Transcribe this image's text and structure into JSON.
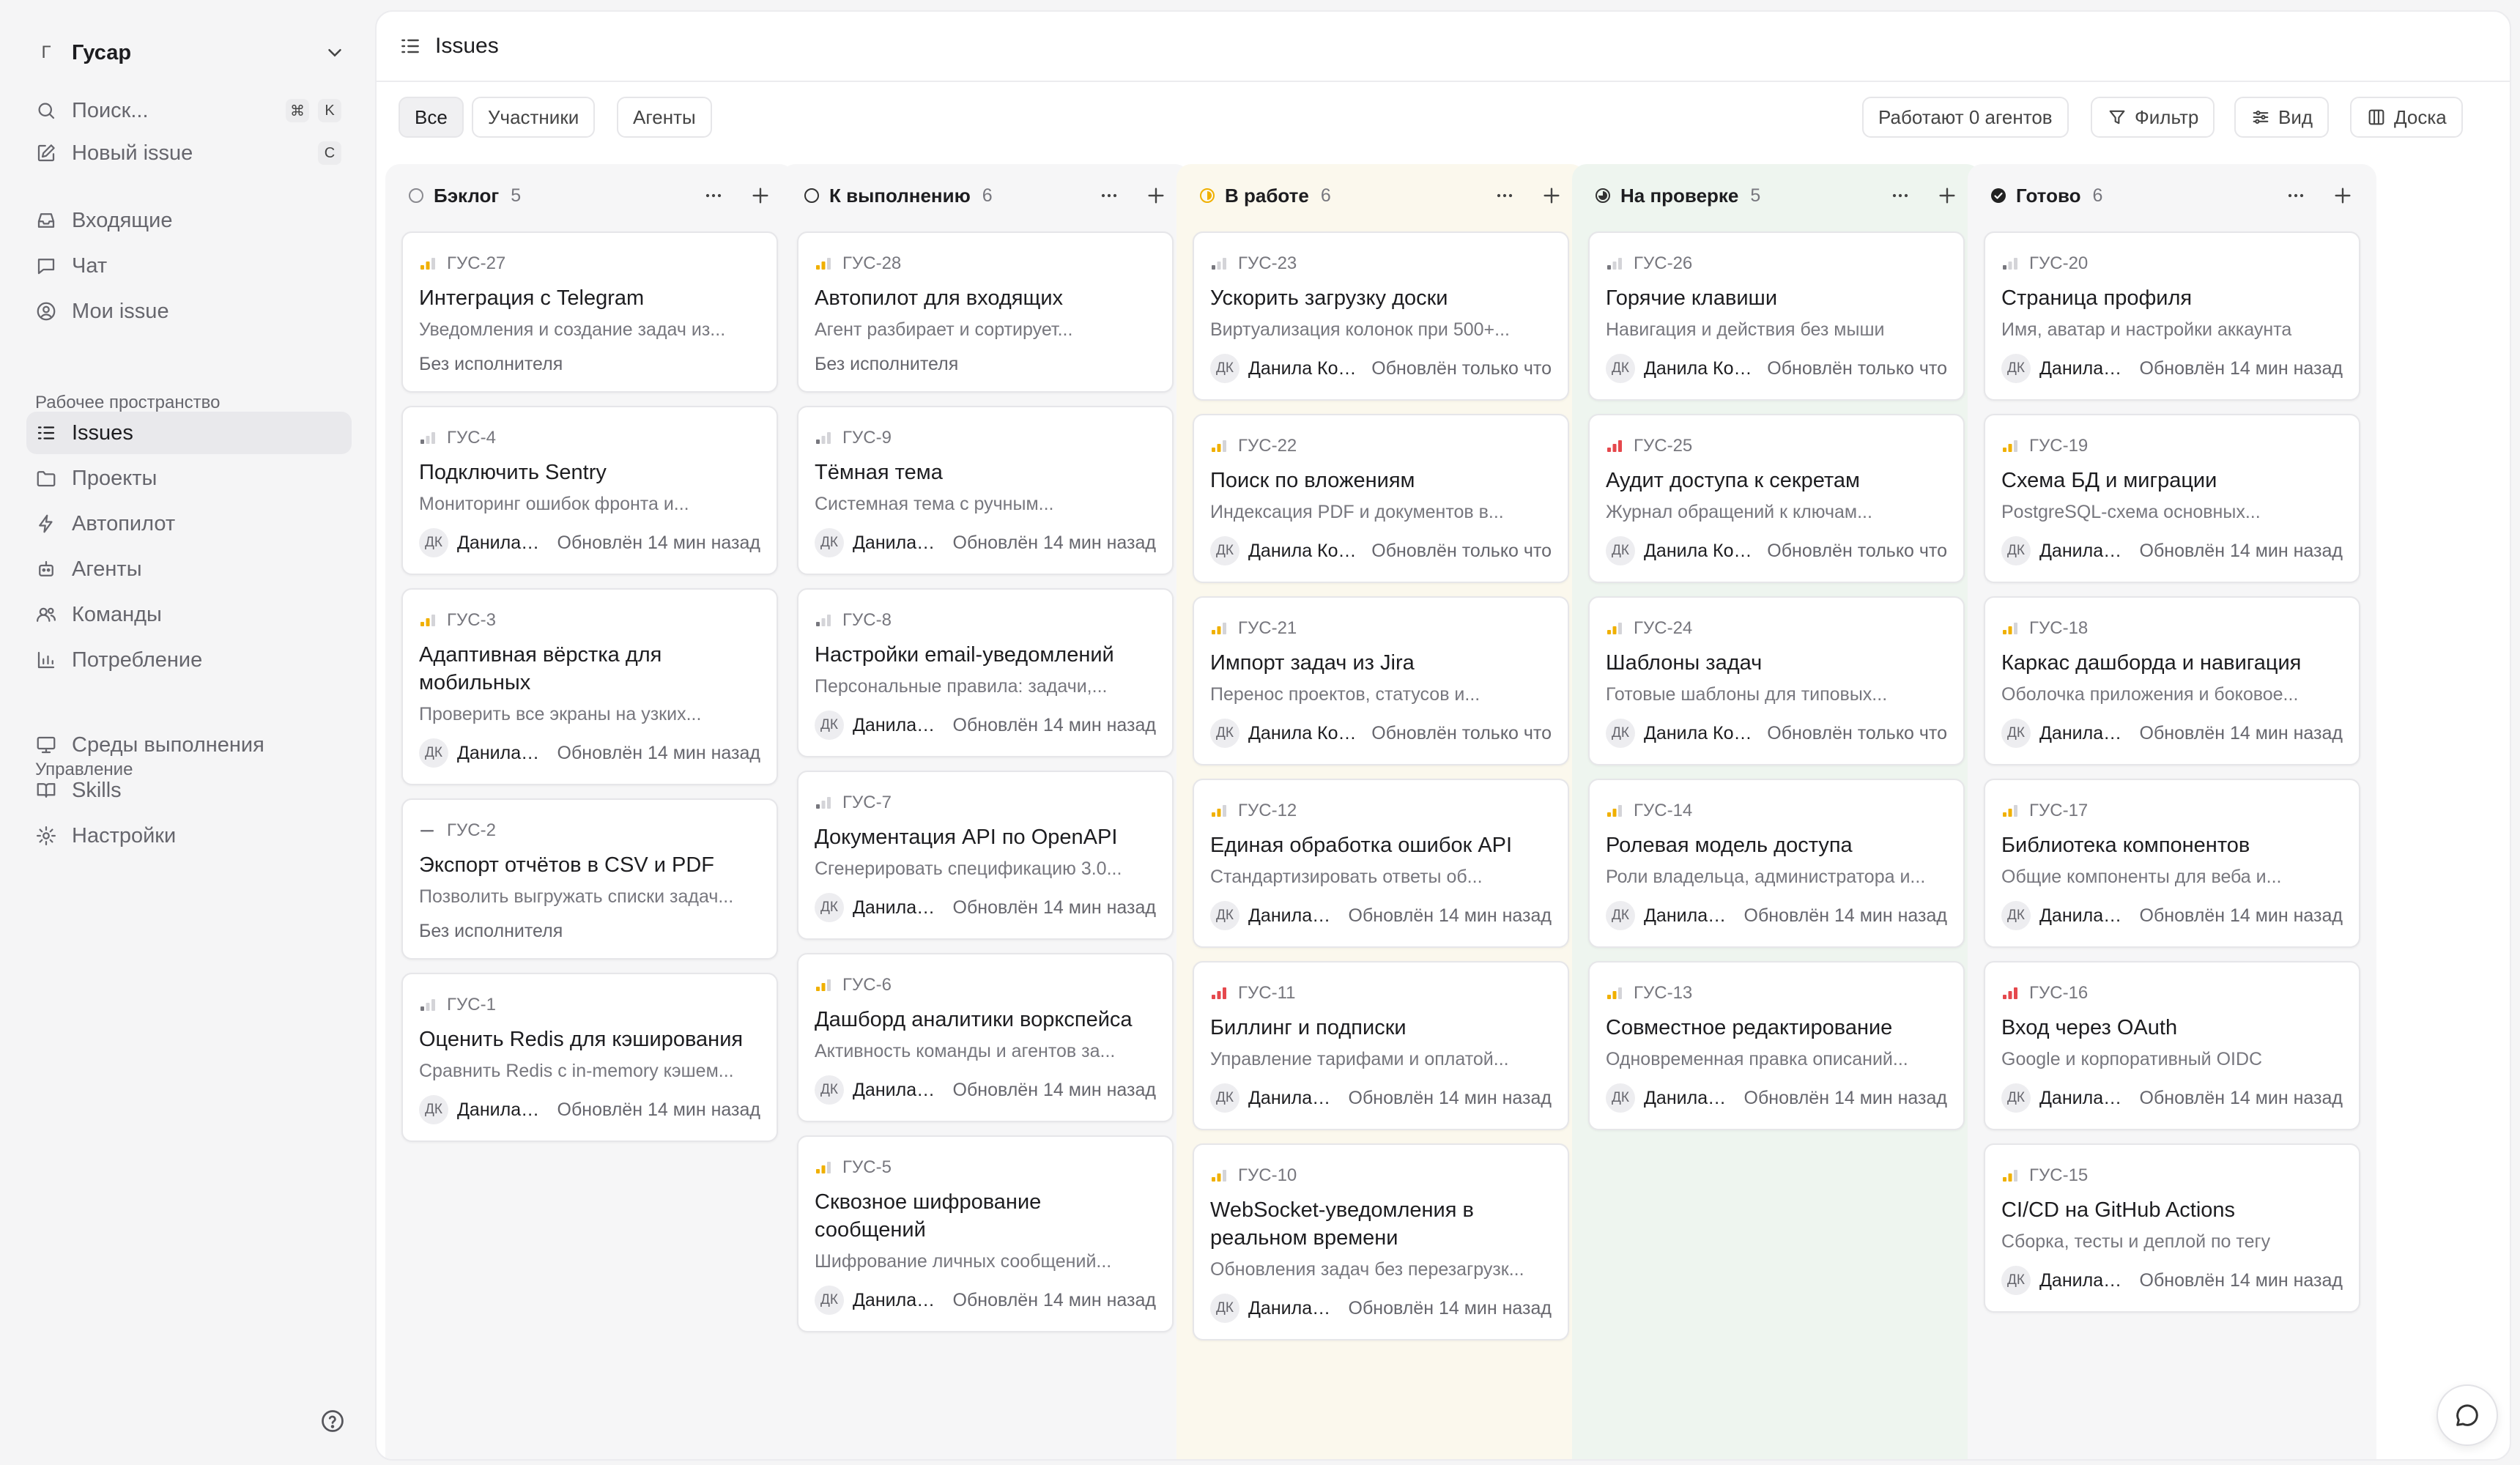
{
  "workspace": {
    "initial": "Г",
    "name": "Гусар"
  },
  "sidebar": {
    "top": [
      {
        "name": "search",
        "label": "Поиск...",
        "icon": "search-icon",
        "keys": [
          "⌘",
          "K"
        ]
      },
      {
        "name": "new-issue",
        "label": "Новый issue",
        "icon": "edit-icon",
        "keys": [
          "C"
        ]
      }
    ],
    "main": [
      {
        "name": "inbox",
        "label": "Входящие",
        "icon": "inbox-icon"
      },
      {
        "name": "chat",
        "label": "Чат",
        "icon": "chat-icon"
      },
      {
        "name": "my-issues",
        "label": "Мои issue",
        "icon": "user-circle-icon"
      }
    ],
    "workspace_title": "Рабочее пространство",
    "workspace_items": [
      {
        "name": "issues",
        "label": "Issues",
        "icon": "list-icon",
        "active": true
      },
      {
        "name": "projects",
        "label": "Проекты",
        "icon": "folder-icon"
      },
      {
        "name": "autopilot",
        "label": "Автопилот",
        "icon": "bolt-icon"
      },
      {
        "name": "agents",
        "label": "Агенты",
        "icon": "bot-icon"
      },
      {
        "name": "teams",
        "label": "Команды",
        "icon": "users-icon"
      },
      {
        "name": "usage",
        "label": "Потребление",
        "icon": "bar-chart-icon"
      }
    ],
    "manage_title": "Управление",
    "manage_items": [
      {
        "name": "runtimes",
        "label": "Среды выполнения",
        "icon": "monitor-icon"
      },
      {
        "name": "skills",
        "label": "Skills",
        "icon": "book-icon"
      },
      {
        "name": "settings",
        "label": "Настройки",
        "icon": "gear-icon"
      }
    ]
  },
  "header": {
    "title": "Issues"
  },
  "filters": {
    "all": "Все",
    "members": "Участники",
    "agents": "Агенты"
  },
  "toolbar": {
    "working": "Работают 0 агентов",
    "filter": "Фильтр",
    "view": "Вид",
    "board": "Доска"
  },
  "columns": [
    {
      "title": "Бэклог",
      "count": "5",
      "status": "backlog",
      "cards": [
        {
          "id": "ГУС-27",
          "title": "Интеграция с Telegram",
          "desc": "Уведомления и создание задач из...",
          "priority": "medium",
          "unassigned": "Без исполнителя"
        },
        {
          "id": "ГУС-4",
          "title": "Подключить Sentry",
          "desc": "Мониторинг ошибок фронта и...",
          "priority": "low",
          "avatar": "ДК",
          "assignee": "Данила Ковалёв",
          "updated": "Обновлён 14 мин назад"
        },
        {
          "id": "ГУС-3",
          "title": "Адаптивная вёрстка для мобильных",
          "desc": "Проверить все экраны на узких...",
          "priority": "medium",
          "avatar": "ДК",
          "assignee": "Данила Ковалёв",
          "updated": "Обновлён 14 мин назад"
        },
        {
          "id": "ГУС-2",
          "title": "Экспорт отчётов в CSV и PDF",
          "desc": "Позволить выгружать списки задач...",
          "priority": "none",
          "unassigned": "Без исполнителя"
        },
        {
          "id": "ГУС-1",
          "title": "Оценить Redis для кэширования",
          "desc": "Сравнить Redis с in-memory кэшем...",
          "priority": "low",
          "avatar": "ДК",
          "assignee": "Данила Ковалёв",
          "updated": "Обновлён 14 мин назад"
        }
      ]
    },
    {
      "title": "К выполнению",
      "count": "6",
      "status": "todo",
      "cards": [
        {
          "id": "ГУС-28",
          "title": "Автопилот для входящих",
          "desc": "Агент разбирает и сортирует...",
          "priority": "medium",
          "unassigned": "Без исполнителя"
        },
        {
          "id": "ГУС-9",
          "title": "Тёмная тема",
          "desc": "Системная тема с ручным...",
          "priority": "low",
          "avatar": "ДК",
          "assignee": "Данила Ковалёв",
          "updated": "Обновлён 14 мин назад"
        },
        {
          "id": "ГУС-8",
          "title": "Настройки email-уведомлений",
          "desc": "Персональные правила: задачи,...",
          "priority": "low",
          "avatar": "ДК",
          "assignee": "Данила Ковалёв",
          "updated": "Обновлён 14 мин назад"
        },
        {
          "id": "ГУС-7",
          "title": "Документация API по OpenAPI",
          "desc": "Сгенерировать спецификацию 3.0...",
          "priority": "low",
          "avatar": "ДК",
          "assignee": "Данила Ковалёв",
          "updated": "Обновлён 14 мин назад"
        },
        {
          "id": "ГУС-6",
          "title": "Дашборд аналитики воркспейса",
          "desc": "Активность команды и агентов за...",
          "priority": "medium",
          "avatar": "ДК",
          "assignee": "Данила Ковалёв",
          "updated": "Обновлён 14 мин назад"
        },
        {
          "id": "ГУС-5",
          "title": "Сквозное шифрование сообщений",
          "desc": "Шифрование личных сообщений...",
          "priority": "medium",
          "avatar": "ДК",
          "assignee": "Данила Ковалёв",
          "updated": "Обновлён 14 мин назад"
        }
      ]
    },
    {
      "title": "В работе",
      "count": "6",
      "status": "in-progress",
      "cards": [
        {
          "id": "ГУС-23",
          "title": "Ускорить загрузку доски",
          "desc": "Виртуализация колонок при 500+...",
          "priority": "low",
          "avatar": "ДК",
          "assignee": "Данила Ковалёв",
          "updated": "Обновлён только что"
        },
        {
          "id": "ГУС-22",
          "title": "Поиск по вложениям",
          "desc": "Индексация PDF и документов в...",
          "priority": "medium",
          "avatar": "ДК",
          "assignee": "Данила Ковалёв",
          "updated": "Обновлён только что"
        },
        {
          "id": "ГУС-21",
          "title": "Импорт задач из Jira",
          "desc": "Перенос проектов, статусов и...",
          "priority": "medium",
          "avatar": "ДК",
          "assignee": "Данила Ковалёв",
          "updated": "Обновлён только что"
        },
        {
          "id": "ГУС-12",
          "title": "Единая обработка ошибок API",
          "desc": "Стандартизировать ответы об...",
          "priority": "medium",
          "avatar": "ДК",
          "assignee": "Данила Ковалёв",
          "updated": "Обновлён 14 мин назад"
        },
        {
          "id": "ГУС-11",
          "title": "Биллинг и подписки",
          "desc": "Управление тарифами и оплатой...",
          "priority": "urgent",
          "avatar": "ДК",
          "assignee": "Данила Ковалёв",
          "updated": "Обновлён 14 мин назад"
        },
        {
          "id": "ГУС-10",
          "title": "WebSocket-уведомления в реальном времени",
          "desc": "Обновления задач без перезагрузк...",
          "priority": "medium",
          "avatar": "ДК",
          "assignee": "Данила Ковалёв",
          "updated": "Обновлён 14 мин назад"
        }
      ]
    },
    {
      "title": "На проверке",
      "count": "5",
      "status": "review",
      "cards": [
        {
          "id": "ГУС-26",
          "title": "Горячие клавиши",
          "desc": "Навигация и действия без мыши",
          "priority": "low",
          "avatar": "ДК",
          "assignee": "Данила Ковалёв",
          "updated": "Обновлён только что"
        },
        {
          "id": "ГУС-25",
          "title": "Аудит доступа к секретам",
          "desc": "Журнал обращений к ключам...",
          "priority": "urgent",
          "avatar": "ДК",
          "assignee": "Данила Ковалёв",
          "updated": "Обновлён только что"
        },
        {
          "id": "ГУС-24",
          "title": "Шаблоны задач",
          "desc": "Готовые шаблоны для типовых...",
          "priority": "medium",
          "avatar": "ДК",
          "assignee": "Данила Ковалёв",
          "updated": "Обновлён только что"
        },
        {
          "id": "ГУС-14",
          "title": "Ролевая модель доступа",
          "desc": "Роли владельца, администратора и...",
          "priority": "medium",
          "avatar": "ДК",
          "assignee": "Данила Ковалёв",
          "updated": "Обновлён 14 мин назад"
        },
        {
          "id": "ГУС-13",
          "title": "Совместное редактирование",
          "desc": "Одновременная правка описаний...",
          "priority": "medium",
          "avatar": "ДК",
          "assignee": "Данила Ковалёв",
          "updated": "Обновлён 14 мин назад"
        }
      ]
    },
    {
      "title": "Готово",
      "count": "6",
      "status": "done",
      "cards": [
        {
          "id": "ГУС-20",
          "title": "Страница профиля",
          "desc": "Имя, аватар и настройки аккаунта",
          "priority": "low",
          "avatar": "ДК",
          "assignee": "Данила Ковалёв",
          "updated": "Обновлён 14 мин назад"
        },
        {
          "id": "ГУС-19",
          "title": "Схема БД и миграции",
          "desc": "PostgreSQL-схема основных...",
          "priority": "medium",
          "avatar": "ДК",
          "assignee": "Данила Ковалёв",
          "updated": "Обновлён 14 мин назад"
        },
        {
          "id": "ГУС-18",
          "title": "Каркас дашборда и навигация",
          "desc": "Оболочка приложения и боковое...",
          "priority": "medium",
          "avatar": "ДК",
          "assignee": "Данила Ковалёв",
          "updated": "Обновлён 14 мин назад"
        },
        {
          "id": "ГУС-17",
          "title": "Библиотека компонентов",
          "desc": "Общие компоненты для веба и...",
          "priority": "medium",
          "avatar": "ДК",
          "assignee": "Данила Ковалёв",
          "updated": "Обновлён 14 мин назад"
        },
        {
          "id": "ГУС-16",
          "title": "Вход через OAuth",
          "desc": "Google и корпоративный OIDC",
          "priority": "urgent",
          "avatar": "ДК",
          "assignee": "Данила Ковалёв",
          "updated": "Обновлён 14 мин назад"
        },
        {
          "id": "ГУС-15",
          "title": "CI/CD на GitHub Actions",
          "desc": "Сборка, тесты и деплой по тегу",
          "priority": "medium",
          "avatar": "ДК",
          "assignee": "Данила Ковалёв",
          "updated": "Обновлён 14 мин назад"
        }
      ]
    }
  ],
  "colors": {
    "backlog_bg": "#f6f6f7",
    "todo_bg": "#f6f6f7",
    "in_progress_bg": "#fbf8ed",
    "review_bg": "#eef5ef",
    "done_bg": "#f6f6f7",
    "in_progress_accent": "#f0b000",
    "priority_medium": "#f0b000",
    "priority_urgent": "#e5484d"
  }
}
